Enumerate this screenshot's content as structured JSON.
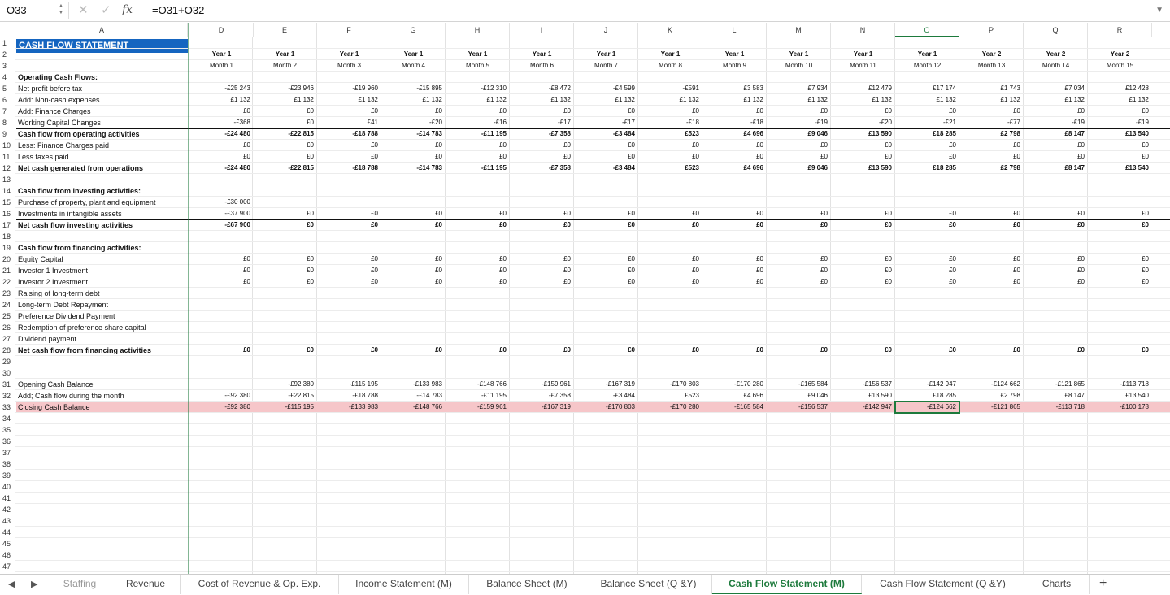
{
  "formula_bar": {
    "name_box": "O33",
    "formula": "=O31+O32"
  },
  "columns": [
    "A",
    "D",
    "E",
    "F",
    "G",
    "H",
    "I",
    "J",
    "K",
    "L",
    "M",
    "N",
    "O",
    "P",
    "Q",
    "R"
  ],
  "selected_column": "O",
  "title": "CASH FLOW STATEMENT",
  "years": [
    "Year 1",
    "Year 1",
    "Year 1",
    "Year 1",
    "Year 1",
    "Year 1",
    "Year 1",
    "Year 1",
    "Year 1",
    "Year 1",
    "Year 1",
    "Year 1",
    "Year 2",
    "Year 2",
    "Year 2"
  ],
  "months": [
    "Month 1",
    "Month 2",
    "Month 3",
    "Month 4",
    "Month 5",
    "Month 6",
    "Month 7",
    "Month 8",
    "Month 9",
    "Month 10",
    "Month 11",
    "Month 12",
    "Month 13",
    "Month 14",
    "Month 15"
  ],
  "rows": [
    {
      "n": "1"
    },
    {
      "n": "2"
    },
    {
      "n": "3"
    },
    {
      "n": "4",
      "label": "Operating Cash Flows:",
      "bold": true
    },
    {
      "n": "5",
      "label": "Net profit before tax",
      "values": [
        "-£25 243",
        "-£23 946",
        "-£19 960",
        "-£15 895",
        "-£12 310",
        "-£8 472",
        "-£4 599",
        "-£591",
        "£3 583",
        "£7 934",
        "£12 479",
        "£17 174",
        "£1 743",
        "£7 034",
        "£12 428"
      ]
    },
    {
      "n": "6",
      "label": "Add: Non-cash expenses",
      "values": [
        "£1 132",
        "£1 132",
        "£1 132",
        "£1 132",
        "£1 132",
        "£1 132",
        "£1 132",
        "£1 132",
        "£1 132",
        "£1 132",
        "£1 132",
        "£1 132",
        "£1 132",
        "£1 132",
        "£1 132"
      ]
    },
    {
      "n": "7",
      "label": "Add: Finance Charges",
      "values": [
        "£0",
        "£0",
        "£0",
        "£0",
        "£0",
        "£0",
        "£0",
        "£0",
        "£0",
        "£0",
        "£0",
        "£0",
        "£0",
        "£0",
        "£0"
      ]
    },
    {
      "n": "8",
      "label": "Working Capital Changes",
      "values": [
        "-£368",
        "£0",
        "£41",
        "-£20",
        "-£16",
        "-£17",
        "-£17",
        "-£18",
        "-£18",
        "-£19",
        "-£20",
        "-£21",
        "-£77",
        "-£19",
        "-£19"
      ]
    },
    {
      "n": "9",
      "label": "Cash flow from operating activities",
      "bold": true,
      "topline": true,
      "values": [
        "-£24 480",
        "-£22 815",
        "-£18 788",
        "-£14 783",
        "-£11 195",
        "-£7 358",
        "-£3 484",
        "£523",
        "£4 696",
        "£9 046",
        "£13 590",
        "£18 285",
        "£2 798",
        "£8 147",
        "£13 540"
      ]
    },
    {
      "n": "10",
      "label": "Less: Finance Charges paid",
      "values": [
        "£0",
        "£0",
        "£0",
        "£0",
        "£0",
        "£0",
        "£0",
        "£0",
        "£0",
        "£0",
        "£0",
        "£0",
        "£0",
        "£0",
        "£0"
      ]
    },
    {
      "n": "11",
      "label": "Less taxes paid",
      "values": [
        "£0",
        "£0",
        "£0",
        "£0",
        "£0",
        "£0",
        "£0",
        "£0",
        "£0",
        "£0",
        "£0",
        "£0",
        "£0",
        "£0",
        "£0"
      ]
    },
    {
      "n": "12",
      "label": "Net cash generated from operations",
      "bold": true,
      "topline": true,
      "values": [
        "-£24 480",
        "-£22 815",
        "-£18 788",
        "-£14 783",
        "-£11 195",
        "-£7 358",
        "-£3 484",
        "£523",
        "£4 696",
        "£9 046",
        "£13 590",
        "£18 285",
        "£2 798",
        "£8 147",
        "£13 540"
      ]
    },
    {
      "n": "13"
    },
    {
      "n": "14",
      "label": "Cash flow from investing activities:",
      "bold": true
    },
    {
      "n": "15",
      "label": "Purchase of property, plant and equipment",
      "values": [
        "-£30 000",
        "",
        "",
        "",
        "",
        "",
        "",
        "",
        "",
        "",
        "",
        "",
        "",
        "",
        ""
      ]
    },
    {
      "n": "16",
      "label": "Investments in intangible assets",
      "values": [
        "-£37 900",
        "£0",
        "£0",
        "£0",
        "£0",
        "£0",
        "£0",
        "£0",
        "£0",
        "£0",
        "£0",
        "£0",
        "£0",
        "£0",
        "£0"
      ]
    },
    {
      "n": "17",
      "label": "Net cash flow investing activities",
      "bold": true,
      "topline": true,
      "values": [
        "-£67 900",
        "£0",
        "£0",
        "£0",
        "£0",
        "£0",
        "£0",
        "£0",
        "£0",
        "£0",
        "£0",
        "£0",
        "£0",
        "£0",
        "£0"
      ]
    },
    {
      "n": "18"
    },
    {
      "n": "19",
      "label": "Cash flow from financing activities:",
      "bold": true
    },
    {
      "n": "20",
      "label": "Equity Capital",
      "values": [
        "£0",
        "£0",
        "£0",
        "£0",
        "£0",
        "£0",
        "£0",
        "£0",
        "£0",
        "£0",
        "£0",
        "£0",
        "£0",
        "£0",
        "£0"
      ]
    },
    {
      "n": "21",
      "label": "Investor 1 Investment",
      "values": [
        "£0",
        "£0",
        "£0",
        "£0",
        "£0",
        "£0",
        "£0",
        "£0",
        "£0",
        "£0",
        "£0",
        "£0",
        "£0",
        "£0",
        "£0"
      ]
    },
    {
      "n": "22",
      "label": "Investor 2 Investment",
      "values": [
        "£0",
        "£0",
        "£0",
        "£0",
        "£0",
        "£0",
        "£0",
        "£0",
        "£0",
        "£0",
        "£0",
        "£0",
        "£0",
        "£0",
        "£0"
      ]
    },
    {
      "n": "23",
      "label": "Raising of long-term debt"
    },
    {
      "n": "24",
      "label": "Long-term Debt Repayment"
    },
    {
      "n": "25",
      "label": "Preference Dividend Payment"
    },
    {
      "n": "26",
      "label": "Redemption of preference share capital"
    },
    {
      "n": "27",
      "label": "Dividend payment"
    },
    {
      "n": "28",
      "label": "Net cash flow from financing activities",
      "bold": true,
      "topline": true,
      "values": [
        "£0",
        "£0",
        "£0",
        "£0",
        "£0",
        "£0",
        "£0",
        "£0",
        "£0",
        "£0",
        "£0",
        "£0",
        "£0",
        "£0",
        "£0"
      ]
    },
    {
      "n": "29"
    },
    {
      "n": "30"
    },
    {
      "n": "31",
      "label": "Opening Cash Balance",
      "values": [
        "",
        "-£92 380",
        "-£115 195",
        "-£133 983",
        "-£148 766",
        "-£159 961",
        "-£167 319",
        "-£170 803",
        "-£170 280",
        "-£165 584",
        "-£156 537",
        "-£142 947",
        "-£124 662",
        "-£121 865",
        "-£113 718"
      ]
    },
    {
      "n": "32",
      "label": "Add; Cash flow during the month",
      "values": [
        "-£92 380",
        "-£22 815",
        "-£18 788",
        "-£14 783",
        "-£11 195",
        "-£7 358",
        "-£3 484",
        "£523",
        "£4 696",
        "£9 046",
        "£13 590",
        "£18 285",
        "£2 798",
        "£8 147",
        "£13 540"
      ]
    },
    {
      "n": "33",
      "label": "Closing Cash Balance",
      "pink": true,
      "topline": true,
      "values": [
        "-£92 380",
        "-£115 195",
        "-£133 983",
        "-£148 766",
        "-£159 961",
        "-£167 319",
        "-£170 803",
        "-£170 280",
        "-£165 584",
        "-£156 537",
        "-£142 947",
        "-£124 662",
        "-£121 865",
        "-£113 718",
        "-£100 178"
      ]
    },
    {
      "n": "34"
    },
    {
      "n": "35"
    },
    {
      "n": "36"
    },
    {
      "n": "37"
    },
    {
      "n": "38"
    },
    {
      "n": "39"
    },
    {
      "n": "40"
    },
    {
      "n": "41"
    },
    {
      "n": "42"
    },
    {
      "n": "43"
    },
    {
      "n": "44"
    },
    {
      "n": "45"
    },
    {
      "n": "46"
    },
    {
      "n": "47"
    }
  ],
  "tabs": [
    {
      "label": "Staffing",
      "state": "muted"
    },
    {
      "label": "Revenue",
      "state": ""
    },
    {
      "label": "Cost of Revenue & Op. Exp.",
      "state": ""
    },
    {
      "label": "Income Statement (M)",
      "state": ""
    },
    {
      "label": "Balance Sheet (M)",
      "state": ""
    },
    {
      "label": "Balance Sheet (Q &Y)",
      "state": ""
    },
    {
      "label": "Cash Flow Statement (M)",
      "state": "active"
    },
    {
      "label": "Cash Flow Statement (Q &Y)",
      "state": ""
    },
    {
      "label": "Charts",
      "state": ""
    }
  ],
  "icons": {
    "add_sheet": "+",
    "prev": "◀",
    "next": "▶"
  }
}
